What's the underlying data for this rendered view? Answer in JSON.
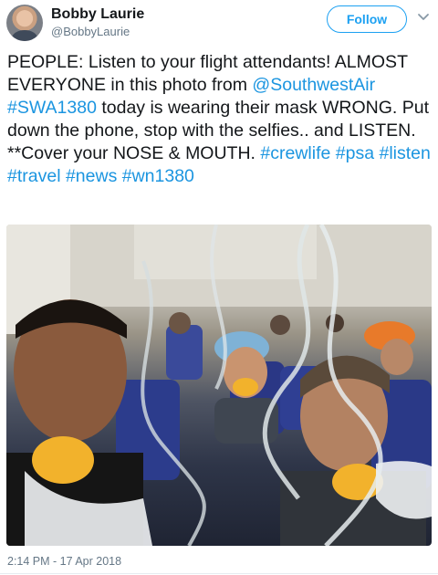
{
  "user": {
    "name": "Bobby Laurie",
    "handle": "@BobbyLaurie"
  },
  "actions": {
    "follow_label": "Follow"
  },
  "tweet": {
    "t1": "PEOPLE: Listen to your flight attendants! ALMOST EVERYONE in this photo from ",
    "mention": "@SouthwestAir",
    "s1": " ",
    "tag_swa": "#SWA1380",
    "t2": " today is wearing their mask WRONG. Put down the phone, stop with the selfies.. and LISTEN. **Cover your NOSE & MOUTH. ",
    "tag_crewlife": "#crewlife",
    "s2": " ",
    "tag_psa": "#psa",
    "s3": " ",
    "tag_listen": "#listen",
    "s4": " ",
    "tag_travel": "#travel",
    "s5": " ",
    "tag_news": "#news",
    "s6": " ",
    "tag_wn1380": "#wn1380"
  },
  "meta": {
    "timestamp": "2:14 PM - 17 Apr 2018"
  },
  "colors": {
    "link": "#1b95e0",
    "follow_accent": "#1da1f2",
    "secondary_text": "#657786"
  }
}
